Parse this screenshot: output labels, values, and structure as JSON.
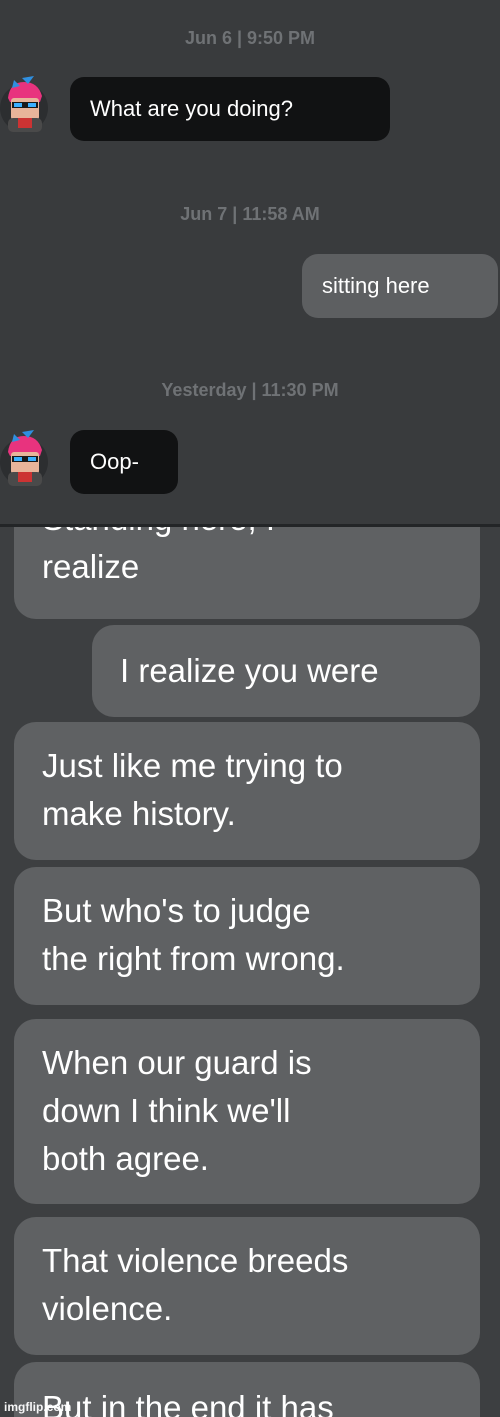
{
  "top_chat": {
    "messages": [
      {
        "timestamp": "Jun 6 | 9:50 PM",
        "sender": "other",
        "text": "What are you doing?"
      },
      {
        "timestamp": "Jun 7 | 11:58 AM",
        "sender": "self",
        "text": "sitting here"
      },
      {
        "timestamp": "Yesterday | 11:30 PM",
        "sender": "other",
        "text": "Oop-"
      }
    ]
  },
  "lower_chat": {
    "messages": [
      {
        "lines": [
          "Standing here, I",
          "realize"
        ],
        "side": "left"
      },
      {
        "lines": [
          "I realize you were"
        ],
        "side": "right"
      },
      {
        "lines": [
          "Just like me trying to",
          "make history."
        ],
        "side": "left"
      },
      {
        "lines": [
          "But who's to judge",
          "the right from wrong."
        ],
        "side": "left"
      },
      {
        "lines": [
          "When our guard is",
          "down I think we'll",
          "both agree."
        ],
        "side": "left"
      },
      {
        "lines": [
          "That violence breeds",
          "violence."
        ],
        "side": "left"
      },
      {
        "lines": [
          "But in the end it has"
        ],
        "side": "left"
      }
    ]
  },
  "watermark": "imgflip.com",
  "colors": {
    "background": "#393b3d",
    "dark_bubble": "#111213",
    "light_bubble": "#5f6163",
    "timestamp": "#6f7275"
  }
}
